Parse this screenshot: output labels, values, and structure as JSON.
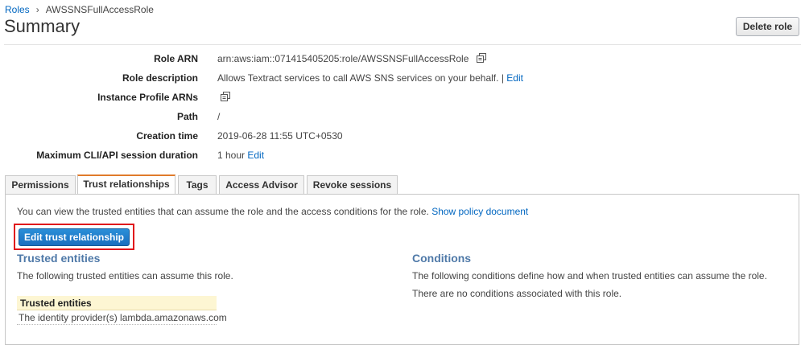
{
  "breadcrumb": {
    "parent": "Roles",
    "separator": "›",
    "current": "AWSSNSFullAccessRole"
  },
  "page_title": "Summary",
  "delete_button": "Delete role",
  "summary": {
    "role_arn": {
      "label": "Role ARN",
      "value": "arn:aws:iam::071415405205:role/AWSSNSFullAccessRole"
    },
    "role_description": {
      "label": "Role description",
      "value": "Allows Textract services to call AWS SNS services on your behalf.",
      "separator": "|",
      "edit_link": "Edit"
    },
    "instance_profile": {
      "label": "Instance Profile ARNs"
    },
    "path": {
      "label": "Path",
      "value": "/"
    },
    "creation_time": {
      "label": "Creation time",
      "value": "2019-06-28 11:55 UTC+0530"
    },
    "session_duration": {
      "label": "Maximum CLI/API session duration",
      "value": "1 hour",
      "edit_link": "Edit"
    }
  },
  "tabs": [
    {
      "label": "Permissions",
      "active": false
    },
    {
      "label": "Trust relationships",
      "active": true
    },
    {
      "label": "Tags",
      "active": false
    },
    {
      "label": "Access Advisor",
      "active": false
    },
    {
      "label": "Revoke sessions",
      "active": false
    }
  ],
  "trust": {
    "intro": "You can view the trusted entities that can assume the role and the access conditions for the role.",
    "policy_link": "Show policy document",
    "edit_button": "Edit trust relationship",
    "entities_title": "Trusted entities",
    "entities_desc": "The following trusted entities can assume this role.",
    "table_header": "Trusted entities",
    "table_rows": [
      "The identity provider(s) lambda.amazonaws.com"
    ],
    "conditions_title": "Conditions",
    "conditions_desc": "The following conditions define how and when trusted entities can assume the role.",
    "conditions_none": "There are no conditions associated with this role."
  },
  "colors": {
    "link": "#0066c0",
    "section_title": "#4f79a8",
    "primary_button": "#1a73c7",
    "highlight_box": "#e0151b",
    "active_tab_accent": "#e07b2a"
  },
  "icons": {
    "copy": "copy-icon"
  }
}
